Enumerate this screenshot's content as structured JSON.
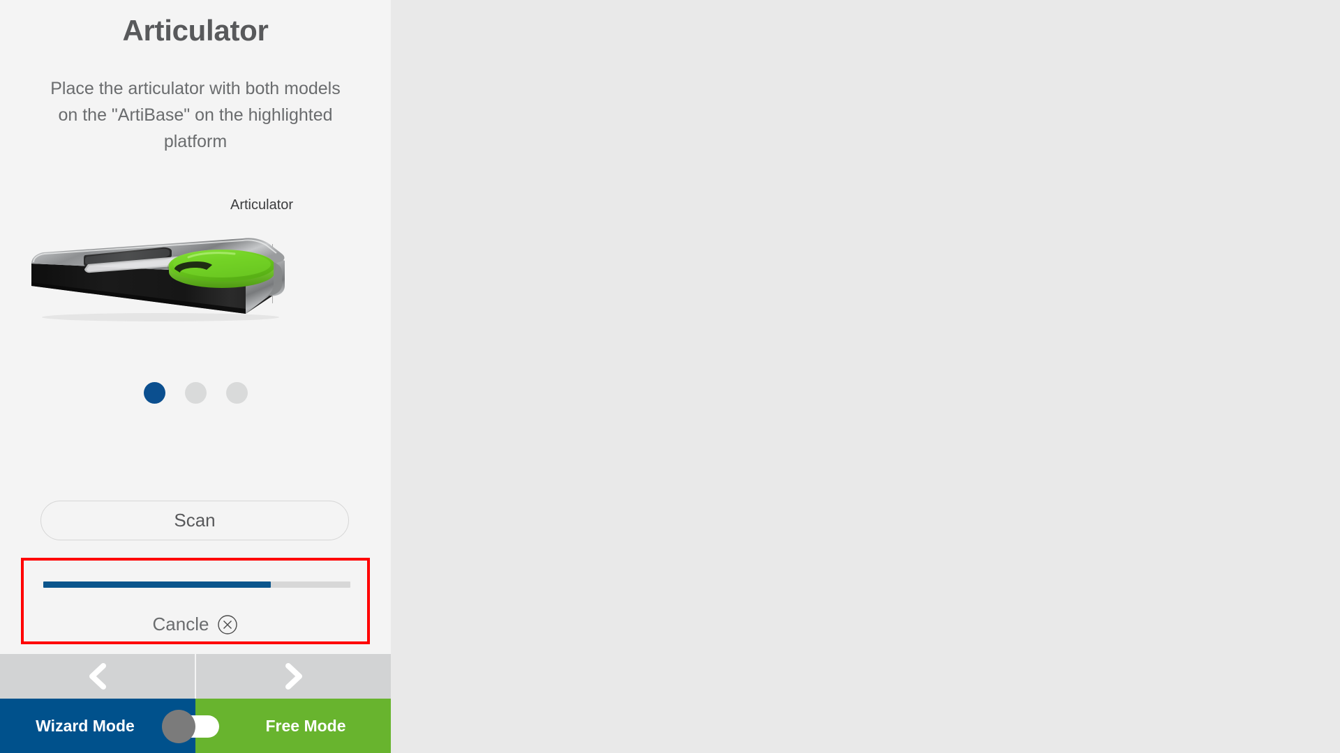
{
  "panel": {
    "title": "Articulator",
    "instruction": "Place the articulator with both models on the \"ArtiBase\" on the highlighted platform",
    "illustration": {
      "callout_label": "Articulator",
      "leader_line": "leader-line",
      "device_name": "artibase-scanner-plate",
      "highlight_color": "#6fd025",
      "body_color": "#1c1c1c",
      "rim_color": "#9a9b9d"
    },
    "pagination": {
      "total": 3,
      "active_index": 0,
      "active_color": "#0b4f8f",
      "inactive_color": "#d9dada"
    },
    "scan_button_label": "Scan",
    "progress": {
      "percent": 74,
      "fill_color": "#0b558c",
      "track_color": "#d7d7d7",
      "highlight_border_color": "#ff0000",
      "cancel_label": "Cancle",
      "cancel_icon": "circle-x-icon"
    },
    "navigation": {
      "prev_icon": "chevron-left-icon",
      "next_icon": "chevron-right-icon"
    },
    "mode": {
      "wizard_label": "Wizard Mode",
      "free_label": "Free Mode",
      "wizard_color": "#00518c",
      "free_color": "#68b42e",
      "selected": "Wizard Mode",
      "knob_color": "#7b7b7b"
    }
  },
  "workspace": {
    "background_color": "#e9e9e9"
  }
}
